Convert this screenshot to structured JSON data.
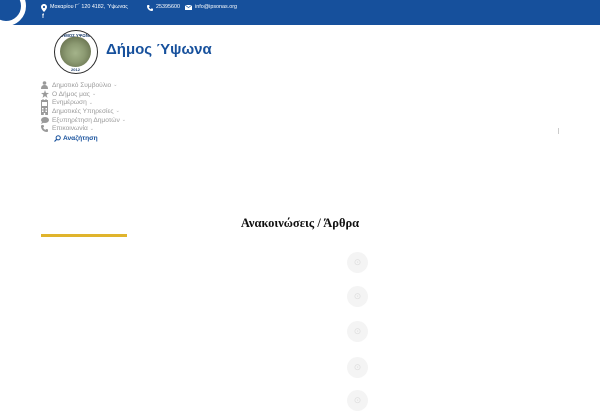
{
  "topbar": {
    "address": "Μακαρίου Γ΄ 120 4182, Ύψωνας",
    "phone": "25395600",
    "email": "info@ipsonas.org",
    "facebook": "f"
  },
  "header": {
    "logo_text": "ΔΗΜΟΣ ΥΨΩΝΑ",
    "logo_year": "2012",
    "site_title": "Δήμος Ύψωνα"
  },
  "nav": {
    "items": [
      {
        "label": "Δημοτικό Συμβούλιο",
        "icon": "person-icon"
      },
      {
        "label": "Ο Δήμος μας",
        "icon": "star-icon"
      },
      {
        "label": "Ενημέρωση",
        "icon": "calendar-icon"
      },
      {
        "label": "Δημοτικές Υπηρεσίες",
        "icon": "building-icon"
      },
      {
        "label": "Εξυπηρέτηση Δημοτών",
        "icon": "chat-icon"
      },
      {
        "label": "Επικοινωνία",
        "icon": "phone-icon"
      }
    ],
    "search_label": "Αναζήτηση"
  },
  "main": {
    "section_title": "Ανακοινώσεις / Άρθρα"
  },
  "colors": {
    "brand_blue": "#16509c",
    "accent_yellow": "#e0b42c",
    "nav_gray": "#9a9a9a"
  }
}
